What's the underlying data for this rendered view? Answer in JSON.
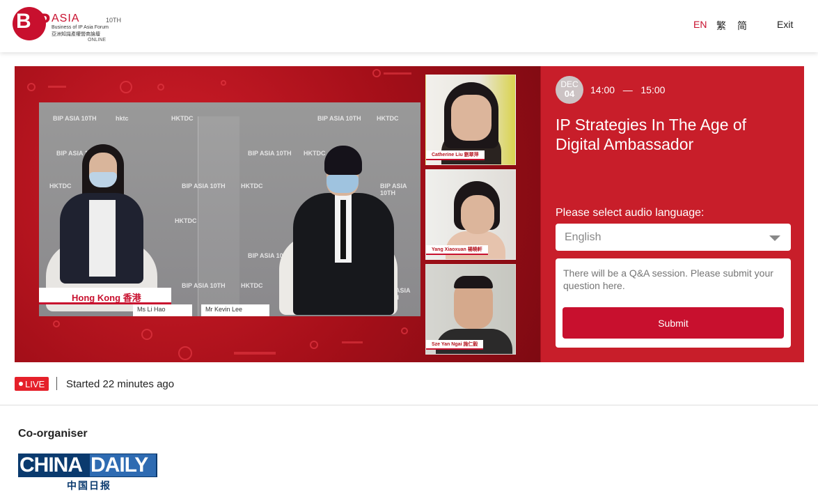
{
  "header": {
    "logo": {
      "b": "B",
      "ip": "IP",
      "asia": "ASIA",
      "edition": "10TH",
      "line1": "Business of IP Asia Forum",
      "line2": "亞洲知識產權營商論壇",
      "online": "ONLINE"
    },
    "languages": {
      "en": "EN",
      "tc": "繁",
      "sc": "简"
    },
    "exit_label": "Exit"
  },
  "video": {
    "location_label": "Hong Kong  香港",
    "speaker_1_name": "Ms Li Hao",
    "speaker_2_name": "Mr Kevin Lee",
    "backdrop_logos": [
      "BIP ASIA 10TH",
      "HKTDC",
      "hktc"
    ],
    "panelists": [
      {
        "name": "Catherine Liu  劉翠萍"
      },
      {
        "name": "Yang Xiaoxuan  楊曉軒"
      },
      {
        "name": "Sze Yan Ngai  施仁毅"
      }
    ]
  },
  "session": {
    "month": "DEC",
    "day": "04",
    "time_range": "14:00   —   15:00",
    "title": "IP Strategies In The Age of Digital Ambassador",
    "audio_label": "Please select audio language:",
    "audio_selected": "English",
    "qa_placeholder": "There will be a Q&A session. Please submit your question here.",
    "submit_label": "Submit"
  },
  "status": {
    "live_label": "LIVE",
    "started_text": "Started 22 minutes ago"
  },
  "footer": {
    "coorganiser_label": "Co-organiser",
    "china_daily": {
      "china": "CHINA",
      "daily": "DAILY",
      "chinese": "中国日报"
    }
  },
  "colors": {
    "brand_red": "#c8102e",
    "panel_red": "#c81e2a",
    "live_red": "#e5202a",
    "china_daily_blue": "#0a3a6e"
  }
}
